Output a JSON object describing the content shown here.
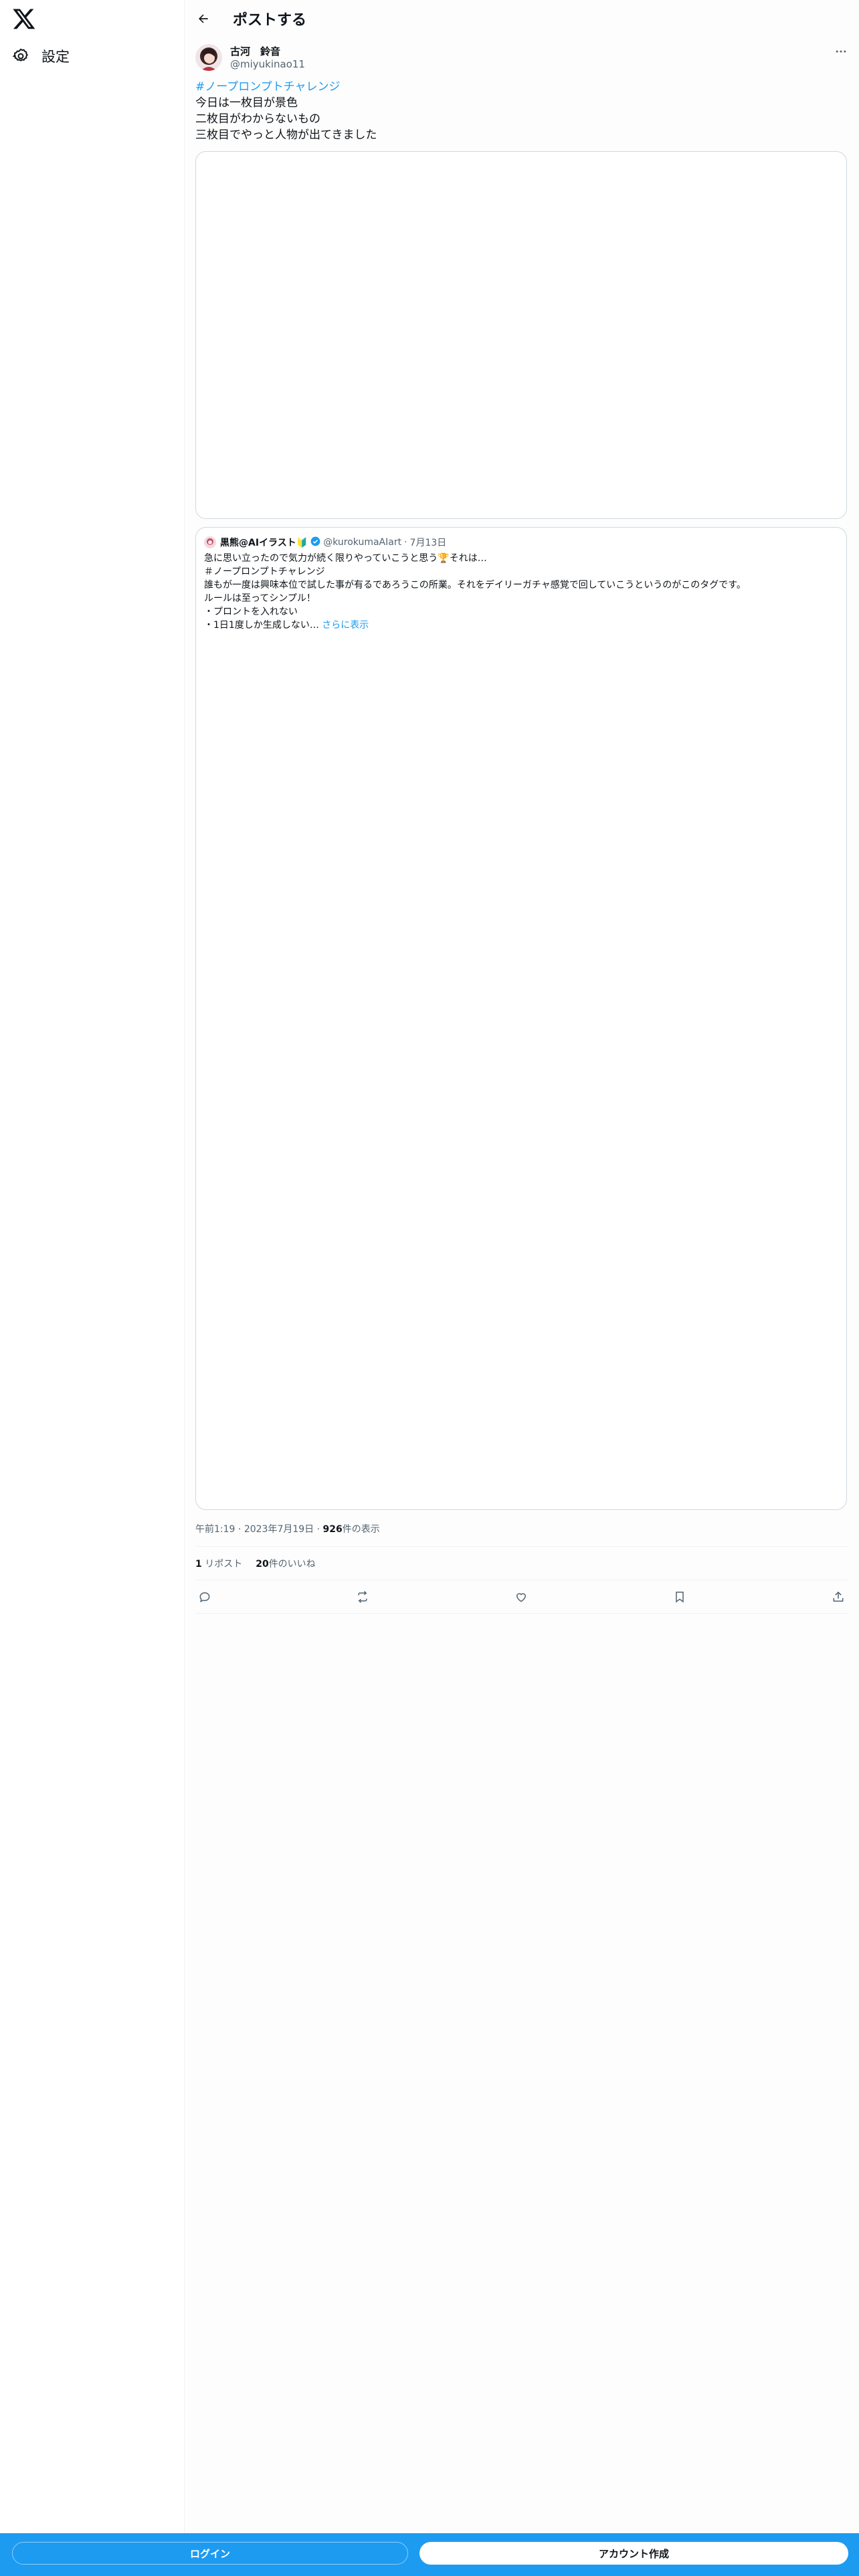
{
  "nav": {
    "settings_label": "設定"
  },
  "header": {
    "title": "ポストする"
  },
  "post": {
    "author_name": "古河　鈴音",
    "author_handle": "@miyukinao11",
    "lines": [
      "#ノープロンプトチャレンジ",
      "今日は一枚目が景色",
      "二枚目がわからないもの",
      "三枚目でやっと人物が出てきました"
    ]
  },
  "quote": {
    "author_name": "黒熊@AIイラスト🔰",
    "author_handle": "@kurokumaAIart",
    "dot": "·",
    "date": "7月13日",
    "lines": [
      "急に思い立ったので気力が続く限りやっていこうと思う🏆それは…",
      "＃ノープロンプトチャレンジ",
      "誰もが一度は興味本位で試した事が有るであろうこの所業。それをデイリーガチャ感覚で回していこうというのがこのタグです。",
      "ルールは至ってシンプル！",
      "・プロントを入れない",
      "・1日1度しか生成しない…"
    ],
    "show_more": "さらに表示"
  },
  "meta": {
    "time": "午前1:19",
    "sep": "·",
    "date": "2023年7月19日",
    "views": "926",
    "views_label": "件の表示"
  },
  "stats": {
    "reposts": "1",
    "reposts_label": "リポスト",
    "likes": "20",
    "likes_label": "件のいいね"
  },
  "icons": [
    "x-logo-icon",
    "gear-icon",
    "back-arrow-icon",
    "more-icon",
    "reply-icon",
    "repost-icon",
    "like-icon",
    "bookmark-icon",
    "share-icon",
    "verified-badge-icon"
  ],
  "bottom_bar": {
    "login_label": "ログイン",
    "signup_label": "アカウント作成"
  },
  "colors": {
    "accent": "#1d9bf0",
    "text": "#0f1419",
    "secondary": "#536471",
    "border": "#cfd9de"
  }
}
